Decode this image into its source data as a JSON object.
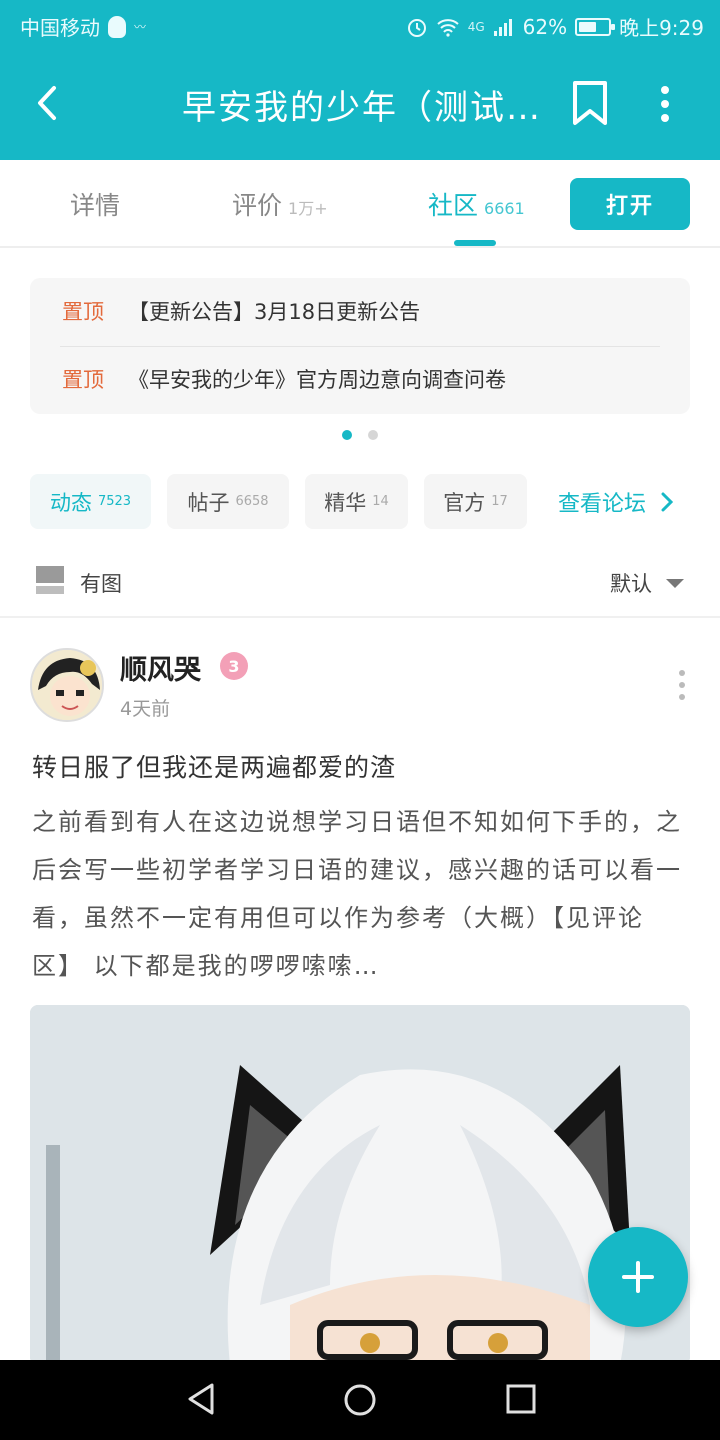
{
  "status_bar": {
    "carrier": "中国移动",
    "signal_label": "4G",
    "battery": "62%",
    "battery_level": 0.62,
    "time": "晚上9:29"
  },
  "header": {
    "title": "早安我的少年（测试…"
  },
  "tabs": [
    {
      "label": "详情",
      "count": ""
    },
    {
      "label": "评价",
      "count": "1万+"
    },
    {
      "label": "社区",
      "count": "6661"
    }
  ],
  "open_button": "打开",
  "pinned": [
    {
      "tag": "置顶",
      "text": "【更新公告】3月18日更新公告"
    },
    {
      "tag": "置顶",
      "text": "《早安我的少年》官方周边意向调查问卷"
    }
  ],
  "filters": [
    {
      "label": "动态",
      "count": "7523"
    },
    {
      "label": "帖子",
      "count": "6658"
    },
    {
      "label": "精华",
      "count": "14"
    },
    {
      "label": "官方",
      "count": "17"
    }
  ],
  "forum_link": "查看论坛",
  "sortbar": {
    "has_image": "有图",
    "sort": "默认"
  },
  "post": {
    "username": "顺风哭",
    "badge": "3",
    "time": "4天前",
    "title": "转日服了但我还是两遍都爱的渣",
    "body": "之前看到有人在这边说想学习日语但不知如何下手的，之后会写一些初学者学习日语的建议，感兴趣的话可以看一看，虽然不一定有用但可以作为参考（大概）【见评论区】 以下都是我的啰啰嗦嗦…"
  },
  "colors": {
    "accent": "#16b8c6",
    "pin_tag": "#e36a3c"
  }
}
